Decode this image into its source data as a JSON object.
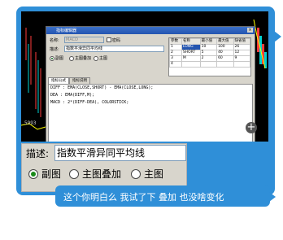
{
  "chart_background": {
    "price_label": "5993"
  },
  "dialog": {
    "title": "指标编辑器",
    "close": "×",
    "name_label": "名称:",
    "name_value": "MACD",
    "password_label": "密码",
    "desc_label": "描述:",
    "desc_value": "指数平滑异同平均线",
    "radios": [
      "副图",
      "主图叠加",
      "主图"
    ],
    "param_table": {
      "headers": [
        "参数",
        "名称",
        "最小值",
        "最大值",
        "缺省值"
      ],
      "rows": [
        [
          "1",
          "LONG",
          "10",
          "100",
          "26"
        ],
        [
          "2",
          "SHORT",
          "5",
          "40",
          "12"
        ],
        [
          "3",
          "M",
          "2",
          "60",
          "9"
        ],
        [
          "4",
          "",
          "",
          "",
          ""
        ]
      ]
    },
    "tabs": [
      "指标公式",
      "指标说明"
    ],
    "code_lines": [
      "DIFF : EMA(CLOSE,SHORT) - EMA(CLOSE,LONG);",
      "DEA  : EMA(DIFF,M);",
      "MACD : 2*(DIFF-DEA), COLORSTICK;"
    ]
  },
  "zoom_button": "+",
  "enlarged_panel": {
    "desc_label": "描述:",
    "desc_value": "指数平滑异同平均线",
    "radios": [
      "副图",
      "主图叠加",
      "主图"
    ],
    "selected": "副图"
  },
  "message": "这个你明白么 我试了下 叠加 也没啥变化",
  "colors": {
    "bubble": "#2f8fd8",
    "dialog_bg": "#d8d5cc",
    "title_bar": "#2455b0"
  }
}
